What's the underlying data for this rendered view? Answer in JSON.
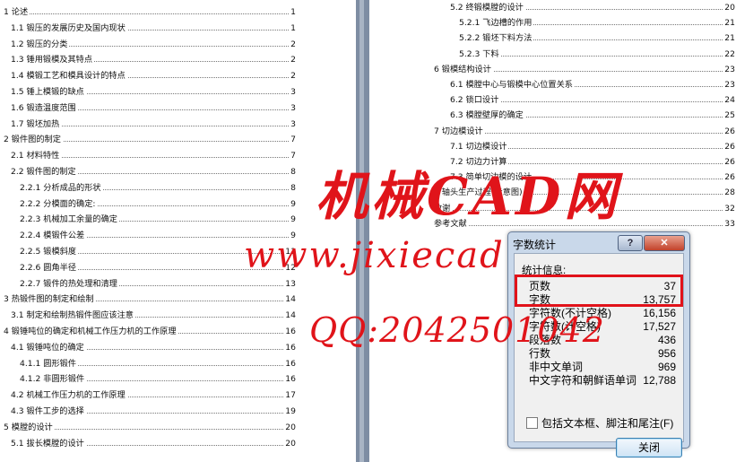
{
  "left_toc": [
    {
      "text": "1 论述",
      "page": "1",
      "level": 0
    },
    {
      "text": "1.1 锻压的发展历史及国内现状",
      "page": "1",
      "level": 1
    },
    {
      "text": "1.2 锻压的分类",
      "page": "2",
      "level": 1
    },
    {
      "text": "1.3 锤用锻模及其特点",
      "page": "2",
      "level": 1
    },
    {
      "text": "1.4 模锻工艺和模具设计的特点",
      "page": "2",
      "level": 1
    },
    {
      "text": "1.5 锤上模锻的缺点",
      "page": "3",
      "level": 1
    },
    {
      "text": "1.6 锻造温度范围",
      "page": "3",
      "level": 1
    },
    {
      "text": "1.7 锻坯加热",
      "page": "3",
      "level": 1
    },
    {
      "text": "2 锻件图的制定",
      "page": "7",
      "level": 0
    },
    {
      "text": "2.1 材料特性",
      "page": "7",
      "level": 1
    },
    {
      "text": "2.2 锻件图的制定",
      "page": "8",
      "level": 1
    },
    {
      "text": "2.2.1 分析成品的形状",
      "page": "8",
      "level": 2
    },
    {
      "text": "2.2.2 分模面的确定:",
      "page": "9",
      "level": 2
    },
    {
      "text": "2.2.3 机械加工余量的确定",
      "page": "9",
      "level": 2
    },
    {
      "text": "2.2.4 模锻件公差",
      "page": "9",
      "level": 2
    },
    {
      "text": "2.2.5 锻模斜度",
      "page": "11",
      "level": 2
    },
    {
      "text": "2.2.6 圆角半径",
      "page": "12",
      "level": 2
    },
    {
      "text": "2.2.7 锻件的热处理和清理",
      "page": "13",
      "level": 2
    },
    {
      "text": "3 热锻件图的制定和绘制",
      "page": "14",
      "level": 0
    },
    {
      "text": "3.1 制定和绘制热锻件图应该注意",
      "page": "14",
      "level": 1
    },
    {
      "text": "4 锻锤吨位的确定和机械工作压力机的工作原理",
      "page": "16",
      "level": 0
    },
    {
      "text": "4.1 锻锤吨位的确定",
      "page": "16",
      "level": 1
    },
    {
      "text": "4.1.1 圆形锻件",
      "page": "16",
      "level": 2
    },
    {
      "text": "4.1.2 非圆形锻件",
      "page": "16",
      "level": 2
    },
    {
      "text": "4.2 机械工作压力机的工作原理",
      "page": "17",
      "level": 1
    },
    {
      "text": "4.3 锻件工步的选择",
      "page": "19",
      "level": 1
    },
    {
      "text": "5 模膛的设计",
      "page": "20",
      "level": 0
    },
    {
      "text": "5.1 拔长模膛的设计",
      "page": "20",
      "level": 1
    }
  ],
  "right_toc": [
    {
      "text": "5.2 终锻模膛的设计",
      "page": "20",
      "level": 1
    },
    {
      "text": "5.2.1 飞边槽的作用",
      "page": "21",
      "level": 2
    },
    {
      "text": "5.2.2 锻坯下料方法",
      "page": "21",
      "level": 2
    },
    {
      "text": "5.2.3 下料",
      "page": "22",
      "level": 2
    },
    {
      "text": "6 锻模结构设计",
      "page": "23",
      "level": 0
    },
    {
      "text": "6.1 模膛中心与锻模中心位置关系",
      "page": "23",
      "level": 1
    },
    {
      "text": "6.2 锁口设计",
      "page": "24",
      "level": 1
    },
    {
      "text": "6.3 模膛壁厚的确定",
      "page": "25",
      "level": 1
    },
    {
      "text": "7 切边模设计",
      "page": "26",
      "level": 0
    },
    {
      "text": "7.1 切边模设计",
      "page": "26",
      "level": 1
    },
    {
      "text": "7.2 切边力计算",
      "page": "26",
      "level": 1
    },
    {
      "text": "7.3 简单切边模的设计",
      "page": "26",
      "level": 1
    },
    {
      "text": "8 轴头生产过程(示意图)",
      "page": "28",
      "level": 0
    },
    {
      "text": "致谢",
      "page": "32",
      "level": 0
    },
    {
      "text": "参考文献",
      "page": "33",
      "level": 0
    }
  ],
  "watermark": {
    "title": "机械CAD网",
    "url": "www.jixiecad.com",
    "qq": "QQ:2042501042"
  },
  "dialog": {
    "title": "字数统计",
    "help_glyph": "?",
    "close_glyph": "✕",
    "group_label": "统计信息:",
    "stats": [
      {
        "label": "页数",
        "value": "37"
      },
      {
        "label": "字数",
        "value": "13,757"
      },
      {
        "label": "字符数(不计空格)",
        "value": "16,156"
      },
      {
        "label": "字符数(计空格)",
        "value": "17,527"
      },
      {
        "label": "段落数",
        "value": "436"
      },
      {
        "label": "行数",
        "value": "956"
      },
      {
        "label": "非中文单词",
        "value": "969"
      },
      {
        "label": "中文字符和朝鲜语单词",
        "value": "12,788"
      }
    ],
    "checkbox_label": "包括文本框、脚注和尾注(F)",
    "checkbox_checked": false,
    "close_button": "关闭"
  },
  "colors": {
    "watermark_red": "#e0141a",
    "highlight_red": "#e1121a",
    "gutter": "#7e8da3",
    "dialog_frame": "#c9d8ea"
  }
}
